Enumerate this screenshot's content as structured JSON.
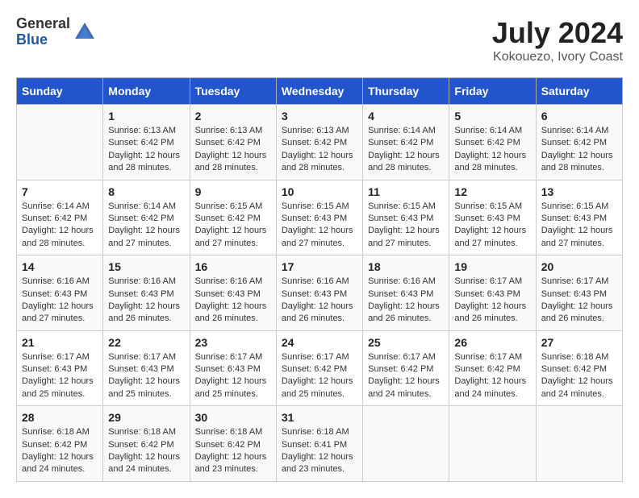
{
  "header": {
    "logo_general": "General",
    "logo_blue": "Blue",
    "month_title": "July 2024",
    "location": "Kokouezo, Ivory Coast"
  },
  "days_of_week": [
    "Sunday",
    "Monday",
    "Tuesday",
    "Wednesday",
    "Thursday",
    "Friday",
    "Saturday"
  ],
  "weeks": [
    [
      {
        "day": "",
        "info": ""
      },
      {
        "day": "1",
        "info": "Sunrise: 6:13 AM\nSunset: 6:42 PM\nDaylight: 12 hours\nand 28 minutes."
      },
      {
        "day": "2",
        "info": "Sunrise: 6:13 AM\nSunset: 6:42 PM\nDaylight: 12 hours\nand 28 minutes."
      },
      {
        "day": "3",
        "info": "Sunrise: 6:13 AM\nSunset: 6:42 PM\nDaylight: 12 hours\nand 28 minutes."
      },
      {
        "day": "4",
        "info": "Sunrise: 6:14 AM\nSunset: 6:42 PM\nDaylight: 12 hours\nand 28 minutes."
      },
      {
        "day": "5",
        "info": "Sunrise: 6:14 AM\nSunset: 6:42 PM\nDaylight: 12 hours\nand 28 minutes."
      },
      {
        "day": "6",
        "info": "Sunrise: 6:14 AM\nSunset: 6:42 PM\nDaylight: 12 hours\nand 28 minutes."
      }
    ],
    [
      {
        "day": "7",
        "info": "Sunrise: 6:14 AM\nSunset: 6:42 PM\nDaylight: 12 hours\nand 28 minutes."
      },
      {
        "day": "8",
        "info": "Sunrise: 6:14 AM\nSunset: 6:42 PM\nDaylight: 12 hours\nand 27 minutes."
      },
      {
        "day": "9",
        "info": "Sunrise: 6:15 AM\nSunset: 6:42 PM\nDaylight: 12 hours\nand 27 minutes."
      },
      {
        "day": "10",
        "info": "Sunrise: 6:15 AM\nSunset: 6:43 PM\nDaylight: 12 hours\nand 27 minutes."
      },
      {
        "day": "11",
        "info": "Sunrise: 6:15 AM\nSunset: 6:43 PM\nDaylight: 12 hours\nand 27 minutes."
      },
      {
        "day": "12",
        "info": "Sunrise: 6:15 AM\nSunset: 6:43 PM\nDaylight: 12 hours\nand 27 minutes."
      },
      {
        "day": "13",
        "info": "Sunrise: 6:15 AM\nSunset: 6:43 PM\nDaylight: 12 hours\nand 27 minutes."
      }
    ],
    [
      {
        "day": "14",
        "info": "Sunrise: 6:16 AM\nSunset: 6:43 PM\nDaylight: 12 hours\nand 27 minutes."
      },
      {
        "day": "15",
        "info": "Sunrise: 6:16 AM\nSunset: 6:43 PM\nDaylight: 12 hours\nand 26 minutes."
      },
      {
        "day": "16",
        "info": "Sunrise: 6:16 AM\nSunset: 6:43 PM\nDaylight: 12 hours\nand 26 minutes."
      },
      {
        "day": "17",
        "info": "Sunrise: 6:16 AM\nSunset: 6:43 PM\nDaylight: 12 hours\nand 26 minutes."
      },
      {
        "day": "18",
        "info": "Sunrise: 6:16 AM\nSunset: 6:43 PM\nDaylight: 12 hours\nand 26 minutes."
      },
      {
        "day": "19",
        "info": "Sunrise: 6:17 AM\nSunset: 6:43 PM\nDaylight: 12 hours\nand 26 minutes."
      },
      {
        "day": "20",
        "info": "Sunrise: 6:17 AM\nSunset: 6:43 PM\nDaylight: 12 hours\nand 26 minutes."
      }
    ],
    [
      {
        "day": "21",
        "info": "Sunrise: 6:17 AM\nSunset: 6:43 PM\nDaylight: 12 hours\nand 25 minutes."
      },
      {
        "day": "22",
        "info": "Sunrise: 6:17 AM\nSunset: 6:43 PM\nDaylight: 12 hours\nand 25 minutes."
      },
      {
        "day": "23",
        "info": "Sunrise: 6:17 AM\nSunset: 6:43 PM\nDaylight: 12 hours\nand 25 minutes."
      },
      {
        "day": "24",
        "info": "Sunrise: 6:17 AM\nSunset: 6:42 PM\nDaylight: 12 hours\nand 25 minutes."
      },
      {
        "day": "25",
        "info": "Sunrise: 6:17 AM\nSunset: 6:42 PM\nDaylight: 12 hours\nand 24 minutes."
      },
      {
        "day": "26",
        "info": "Sunrise: 6:17 AM\nSunset: 6:42 PM\nDaylight: 12 hours\nand 24 minutes."
      },
      {
        "day": "27",
        "info": "Sunrise: 6:18 AM\nSunset: 6:42 PM\nDaylight: 12 hours\nand 24 minutes."
      }
    ],
    [
      {
        "day": "28",
        "info": "Sunrise: 6:18 AM\nSunset: 6:42 PM\nDaylight: 12 hours\nand 24 minutes."
      },
      {
        "day": "29",
        "info": "Sunrise: 6:18 AM\nSunset: 6:42 PM\nDaylight: 12 hours\nand 24 minutes."
      },
      {
        "day": "30",
        "info": "Sunrise: 6:18 AM\nSunset: 6:42 PM\nDaylight: 12 hours\nand 23 minutes."
      },
      {
        "day": "31",
        "info": "Sunrise: 6:18 AM\nSunset: 6:41 PM\nDaylight: 12 hours\nand 23 minutes."
      },
      {
        "day": "",
        "info": ""
      },
      {
        "day": "",
        "info": ""
      },
      {
        "day": "",
        "info": ""
      }
    ]
  ]
}
